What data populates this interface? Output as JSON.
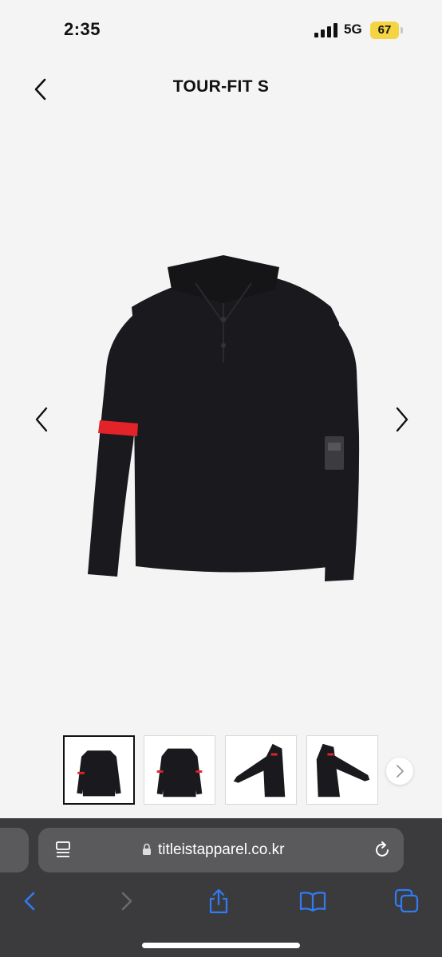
{
  "status": {
    "time": "2:35",
    "network": "5G",
    "battery": "67"
  },
  "header": {
    "title": "TOUR-FIT S"
  },
  "gallery": {
    "active_index": 0,
    "thumbnail_count": 4
  },
  "browser": {
    "url": "titleistapparel.co.kr"
  },
  "colors": {
    "accent": "#2f7cf6",
    "stripe": "#e2242a",
    "shirt": "#1a1a1e"
  },
  "icons": {
    "back": "chevron-left-icon",
    "prev": "chevron-left-icon",
    "next": "chevron-right-icon",
    "reader": "reader-icon",
    "lock": "lock-icon",
    "reload": "reload-icon",
    "share": "share-icon",
    "bookmarks": "book-icon",
    "tabs": "tabs-icon"
  }
}
